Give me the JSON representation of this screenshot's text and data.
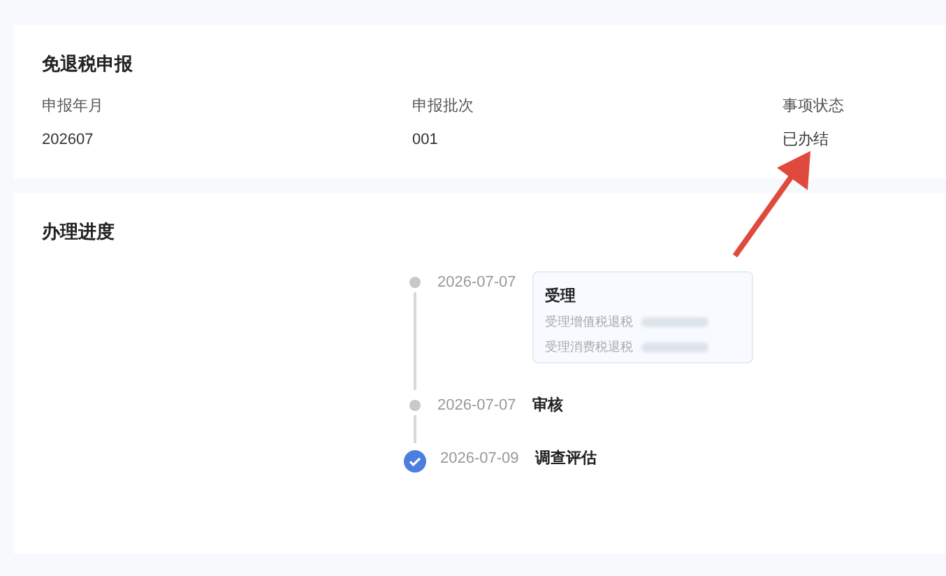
{
  "declaration": {
    "title": "免退税申报",
    "fields": [
      {
        "label": "申报年月",
        "value": "202607"
      },
      {
        "label": "申报批次",
        "value": "001"
      },
      {
        "label": "事项状态",
        "value": "已办结"
      }
    ]
  },
  "progress": {
    "title": "办理进度",
    "steps": [
      {
        "date": "2026-07-07",
        "name": "受理",
        "current": false,
        "details": [
          "受理增值税退税",
          "受理消费税退税"
        ]
      },
      {
        "date": "2026-07-07",
        "name": "审核",
        "current": false
      },
      {
        "date": "2026-07-09",
        "name": "调查评估",
        "current": true
      }
    ]
  }
}
